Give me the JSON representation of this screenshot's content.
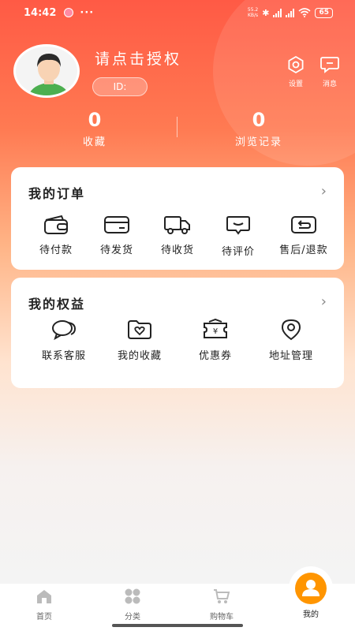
{
  "status_bar": {
    "time": "14:42",
    "more": "···",
    "speed_value": "55.2",
    "speed_unit": "KB/s",
    "battery": "65"
  },
  "profile": {
    "username": "请点击授权",
    "id_label": "ID:",
    "settings_label": "设置",
    "messages_label": "消息"
  },
  "stats": {
    "favorites_count": "0",
    "favorites_label": "收藏",
    "history_count": "0",
    "history_label": "浏览记录"
  },
  "orders": {
    "title": "我的订单",
    "arrow": "›",
    "items": [
      {
        "label": "待付款",
        "icon": "wallet-icon"
      },
      {
        "label": "待发货",
        "icon": "card-icon"
      },
      {
        "label": "待收货",
        "icon": "truck-icon"
      },
      {
        "label": "待评价",
        "icon": "comment-icon"
      },
      {
        "label": "售后/退款",
        "icon": "return-icon"
      }
    ]
  },
  "benefits": {
    "title": "我的权益",
    "arrow": "›",
    "items": [
      {
        "label": "联系客服",
        "icon": "chat-icon"
      },
      {
        "label": "我的收藏",
        "icon": "folder-heart-icon"
      },
      {
        "label": "优惠券",
        "icon": "coupon-icon"
      },
      {
        "label": "地址管理",
        "icon": "location-icon"
      }
    ]
  },
  "bottom_nav": {
    "items": [
      {
        "label": "首页",
        "icon": "home-icon"
      },
      {
        "label": "分类",
        "icon": "grid-icon"
      },
      {
        "label": "购物车",
        "icon": "cart-icon"
      },
      {
        "label": "我的",
        "icon": "user-icon",
        "active": true
      }
    ]
  },
  "colors": {
    "accent": "#ff9500",
    "header_top": "#ff5a45",
    "header_mid": "#ffb486"
  }
}
